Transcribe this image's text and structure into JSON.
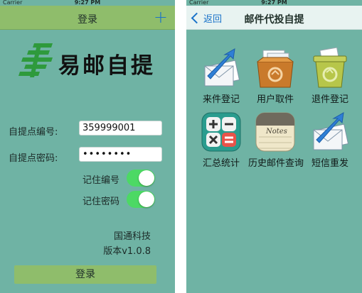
{
  "status_bar": {
    "carrier": "Carrier",
    "time": "9:27 PM"
  },
  "login": {
    "title": "登录",
    "logo_text": "易邮自提",
    "fields": [
      {
        "label": "自提点编号:",
        "value": "359999001"
      },
      {
        "label": "自提点密码:",
        "value": "••••••••"
      }
    ],
    "switches": [
      {
        "label": "记住编号",
        "on": true
      },
      {
        "label": "记住密码",
        "on": true
      }
    ],
    "company": "国通科技",
    "version": "版本v1.0.8",
    "login_button": "登录"
  },
  "dashboard": {
    "title": "邮件代投自提",
    "back_label": "返回",
    "tiles": [
      {
        "label": "来件登记",
        "icon": "mail-arrow-icon"
      },
      {
        "label": "用户取件",
        "icon": "open-box-icon"
      },
      {
        "label": "退件登记",
        "icon": "recycle-bin-icon"
      },
      {
        "label": "汇总统计",
        "icon": "calculator-icon"
      },
      {
        "label": "历史邮件查询",
        "icon": "notes-icon"
      },
      {
        "label": "短信重发",
        "icon": "mail-arrow-icon"
      }
    ],
    "notes_icon_text": "Notes"
  },
  "colors": {
    "background": "#6fb3a4",
    "left_navbar": "#8fbd6b",
    "right_navbar": "#e8f3f1",
    "accent_blue": "#1a73c9",
    "switch_on": "#4cd964",
    "logo_green": "#2e9a3c"
  }
}
